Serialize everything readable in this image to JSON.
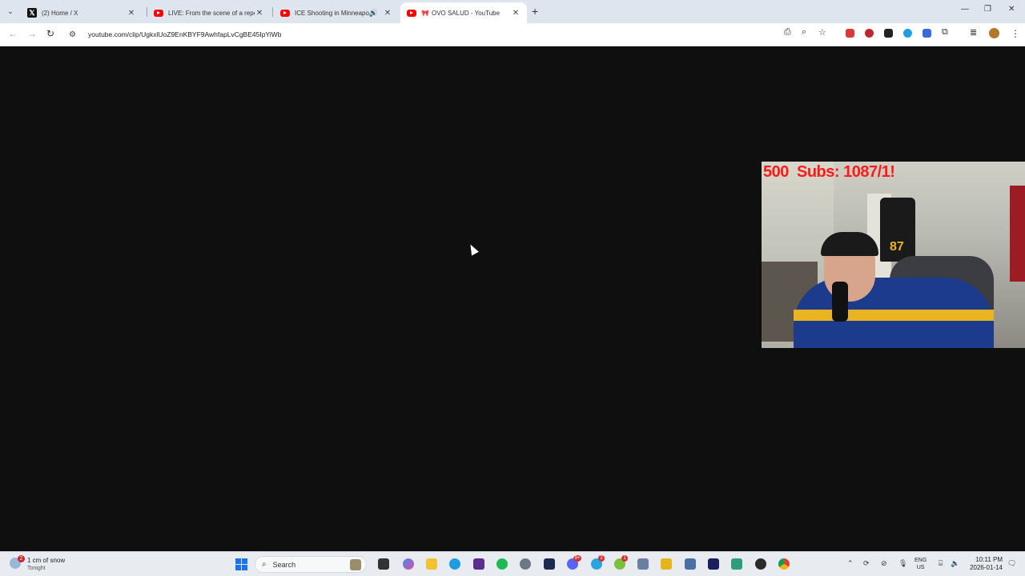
{
  "browser": {
    "tabs": [
      {
        "title": "(2) Home / X",
        "favicon": "x-logo-icon",
        "active": false
      },
      {
        "title": "LIVE: From the scene of a repor",
        "favicon": "youtube-icon",
        "active": false
      },
      {
        "title": "ICE Shooting in Minneapolis",
        "favicon": "youtube-icon",
        "active": false,
        "audio": true
      },
      {
        "title": "OVO SALUD - YouTube",
        "favicon": "youtube-icon",
        "active": true
      }
    ],
    "url": "youtube.com/clip/UgkxlUoZ9EnKBYF9AwhfapLvCgBE45IpYiWb"
  },
  "video": {
    "overlay_text": "500  Subs: 1087/1!",
    "jersey_number": "87"
  },
  "taskbar": {
    "weather": {
      "line1": "1 cm of snow",
      "line2": "Tonight",
      "badge": "2"
    },
    "search_label": "Search",
    "badges": {
      "discord": "9+",
      "telegram": "2",
      "app": "1"
    },
    "language": {
      "line1": "ENG",
      "line2": "US"
    },
    "clock": {
      "time": "10:11 PM",
      "date": "2026-01-14"
    }
  },
  "colors": {
    "tabstrip": "#dfe5ee",
    "page_background": "#0f0f0f",
    "overlay_text": "#ff1a1a",
    "taskbar": "#e8ecf1"
  }
}
